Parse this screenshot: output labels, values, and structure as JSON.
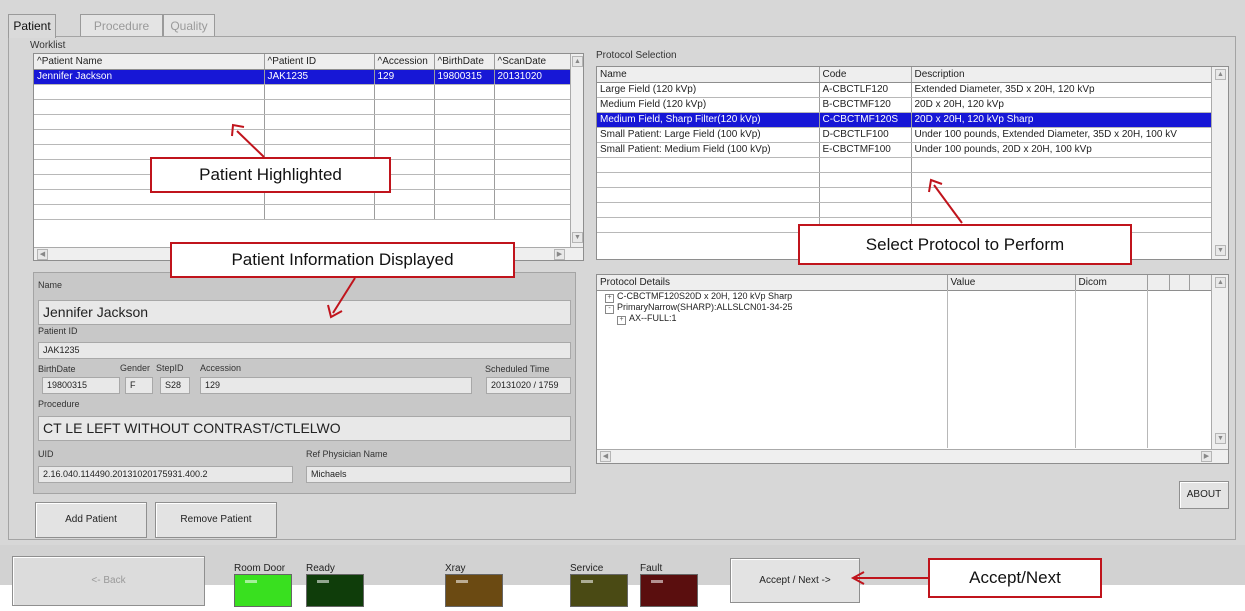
{
  "tabs": [
    {
      "label": "Patient"
    },
    {
      "label": "Procedure"
    },
    {
      "label": "Quality"
    }
  ],
  "worklist": {
    "title": "Worklist",
    "columns": [
      "^Patient Name",
      "^Patient ID",
      "^Accession",
      "^BirthDate",
      "^ScanDate"
    ],
    "rows": [
      [
        "Jennifer Jackson",
        "JAK1235",
        "129",
        "19800315",
        "20131020"
      ]
    ],
    "empty_rows": 9,
    "selected_row": 0
  },
  "protocol_selection": {
    "title": "Protocol Selection",
    "columns": [
      "Name",
      "Code",
      "Description"
    ],
    "rows": [
      [
        "Large Field (120 kVp)",
        "A-CBCTLF120",
        "Extended Diameter, 35D x 20H, 120 kVp"
      ],
      [
        "Medium Field (120 kVp)",
        "B-CBCTMF120",
        "20D x 20H, 120 kVp"
      ],
      [
        "Medium Field, Sharp Filter(120 kVp)",
        "C-CBCTMF120S",
        "20D x 20H, 120 kVp Sharp"
      ],
      [
        "Small Patient: Large Field (100 kVp)",
        "D-CBCTLF100",
        "Under 100 pounds, Extended Diameter, 35D x 20H, 100 kV"
      ],
      [
        "Small Patient: Medium Field (100 kVp)",
        "E-CBCTMF100",
        "Under 100 pounds, 20D x 20H, 100 kVp"
      ]
    ],
    "empty_rows": 5,
    "selected_row": 2
  },
  "protocol_details": {
    "columns": [
      "Protocol Details",
      "Value",
      "Dicom"
    ],
    "tree": [
      {
        "sign": "+",
        "text": "C-CBCTMF120S20D x 20H, 120 kVp Sharp",
        "level": 0
      },
      {
        "sign": "-",
        "text": "PrimaryNarrow(SHARP):ALLSLCN01-34-25",
        "level": 0
      },
      {
        "sign": "+",
        "text": "AX--FULL:1",
        "level": 1
      }
    ]
  },
  "patient_info": {
    "name_label": "Name",
    "name": "Jennifer Jackson",
    "patient_id_label": "Patient ID",
    "patient_id": "JAK1235",
    "birthdate_label": "BirthDate",
    "birthdate": "19800315",
    "gender_label": "Gender",
    "gender": "F",
    "stepid_label": "StepID",
    "stepid": "S28",
    "accession_label": "Accession",
    "accession": "129",
    "scheduled_label": "Scheduled Time",
    "scheduled": "20131020 / 1759",
    "procedure_label": "Procedure",
    "procedure": "CT LE LEFT WITHOUT CONTRAST/CTLELWO",
    "uid_label": "UID",
    "uid": "2.16.040.114490.20131020175931.400.2",
    "physician_label": "Ref Physician Name",
    "physician": "Michaels"
  },
  "buttons": {
    "add_patient": "Add Patient",
    "remove_patient": "Remove Patient",
    "about": "ABOUT",
    "back": "<- Back",
    "accept_next": "Accept / Next ->"
  },
  "status_lights": [
    {
      "label": "Room Door",
      "color": "#39e01f"
    },
    {
      "label": "Ready",
      "color": "#0f3d0a"
    },
    {
      "label": "Xray",
      "color": "#6b4a12"
    },
    {
      "label": "Service",
      "color": "#4a4a14"
    },
    {
      "label": "Fault",
      "color": "#5a0e0e"
    }
  ],
  "callouts": {
    "patient_highlighted": "Patient Highlighted",
    "patient_info_displayed": "Patient Information Displayed",
    "select_protocol": "Select Protocol to Perform",
    "accept_next": "Accept/Next"
  },
  "colors": {
    "selection": "#1717d6",
    "callout_border": "#c0141c"
  }
}
